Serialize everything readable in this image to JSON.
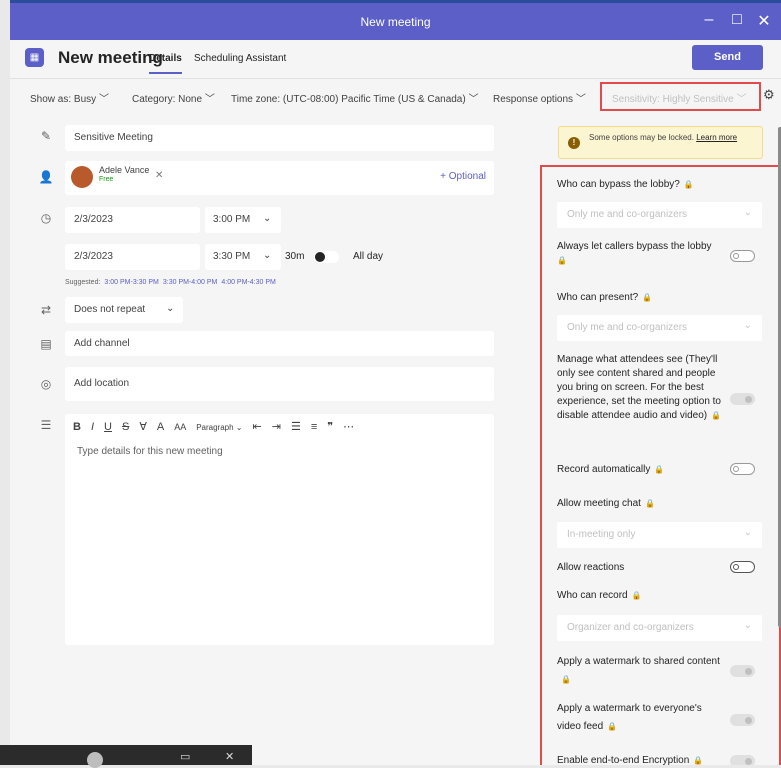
{
  "window": {
    "title": "New meeting",
    "controls": [
      "–",
      "□",
      "✕"
    ]
  },
  "header": {
    "title": "New meeting",
    "tabs": [
      "Details",
      "Scheduling Assistant"
    ],
    "send": "Send"
  },
  "options": {
    "show_as": "Show as: Busy",
    "category": "Category: None",
    "timezone": "Time zone: (UTC-08:00) Pacific Time (US & Canada)",
    "response": "Response options",
    "sensitivity": "Sensitivity: Highly Sensitive"
  },
  "form": {
    "title": "Sensitive Meeting",
    "attendee": {
      "name": "Adele Vance",
      "status": "Free"
    },
    "optional": "+ Optional",
    "start_date": "2/3/2023",
    "start_time": "3:00 PM",
    "end_date": "2/3/2023",
    "end_time": "3:30 PM",
    "duration": "30m",
    "all_day": "All day",
    "suggested_label": "Suggested:",
    "suggested": [
      "3:00 PM-3:30 PM",
      "3:30 PM-4:00 PM",
      "4:00 PM-4:30 PM"
    ],
    "repeat": "Does not repeat",
    "channel": "Add channel",
    "location": "Add location",
    "paragraph": "Paragraph",
    "details_placeholder": "Type details for this new meeting"
  },
  "panel": {
    "warning": "Some options may be locked.",
    "learn_more": "Learn more",
    "bypass_label": "Who can bypass the lobby?",
    "bypass_value": "Only me and co-organizers",
    "callers_label": "Always let callers bypass the lobby",
    "present_label": "Who can present?",
    "present_value": "Only me and co-organizers",
    "manage_label": "Manage what attendees see (They'll only see content shared and people you bring on screen. For the best experience, set the meeting option to disable attendee audio and video)",
    "record_auto_label": "Record automatically",
    "chat_label": "Allow meeting chat",
    "chat_value": "In-meeting only",
    "reactions_label": "Allow reactions",
    "who_record_label": "Who can record",
    "who_record_value": "Organizer and co-organizers",
    "wm_shared_label": "Apply a watermark to shared content",
    "wm_video_label": "Apply a watermark to everyone's video feed",
    "e2e_label": "Enable end-to-end Encryption"
  }
}
